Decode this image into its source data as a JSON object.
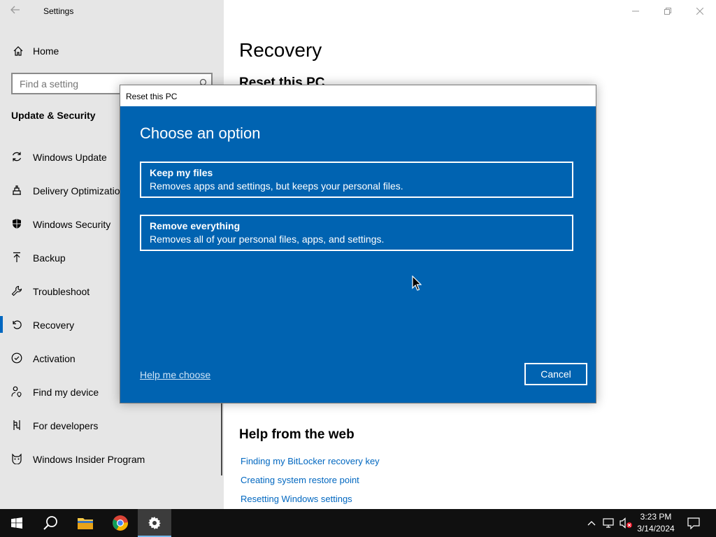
{
  "window": {
    "app_title": "Settings"
  },
  "sidebar": {
    "home_label": "Home",
    "search_placeholder": "Find a setting",
    "section_heading": "Update & Security",
    "items": [
      {
        "label": "Windows Update",
        "icon": "refresh-icon"
      },
      {
        "label": "Delivery Optimization",
        "icon": "delivery-optimization-icon"
      },
      {
        "label": "Windows Security",
        "icon": "shield-icon"
      },
      {
        "label": "Backup",
        "icon": "backup-arrow-icon"
      },
      {
        "label": "Troubleshoot",
        "icon": "wrench-icon"
      },
      {
        "label": "Recovery",
        "icon": "recovery-icon",
        "selected": true
      },
      {
        "label": "Activation",
        "icon": "checkmark-circle-icon"
      },
      {
        "label": "Find my device",
        "icon": "person-location-icon"
      },
      {
        "label": "For developers",
        "icon": "developer-icon"
      },
      {
        "label": "Windows Insider Program",
        "icon": "insider-cat-icon"
      }
    ]
  },
  "main": {
    "page_title": "Recovery",
    "section_reset": "Reset this PC",
    "help_heading": "Help from the web",
    "help_links": [
      "Finding my BitLocker recovery key",
      "Creating system restore point",
      "Resetting Windows settings"
    ]
  },
  "dialog": {
    "title": "Reset this PC",
    "heading": "Choose an option",
    "options": [
      {
        "title": "Keep my files",
        "description": "Removes apps and settings, but keeps your personal files."
      },
      {
        "title": "Remove everything",
        "description": "Removes all of your personal files, apps, and settings."
      }
    ],
    "help_link": "Help me choose",
    "cancel_label": "Cancel"
  },
  "taskbar": {
    "time": "3:23 PM",
    "date": "3/14/2024",
    "accent_color": "#76b9ed"
  },
  "colors": {
    "dialog_background": "#0063b1",
    "link": "#0067c0",
    "sidebar_background": "#e6e6e6"
  }
}
